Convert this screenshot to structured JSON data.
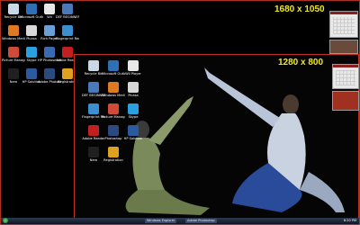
{
  "desktop_outer": {
    "resolution_label": "1680 x 1050",
    "icons": [
      {
        "label": "Recycle Bin",
        "color": "#c9d7e6"
      },
      {
        "label": "Microsoft Outlook",
        "color": "#2f6fb5"
      },
      {
        "label": "Wii",
        "color": "#e8e8e8"
      },
      {
        "label": "DEF BEGINNERS",
        "color": "#4a78b8"
      },
      {
        "label": "Windows Media Player",
        "color": "#e07a20"
      },
      {
        "label": "Picasa",
        "color": "#d8d8d8"
      },
      {
        "label": "Rich Pages",
        "color": "#6aa0d8"
      },
      {
        "label": "Fingerprint Reader",
        "color": "#3a8fd0"
      },
      {
        "label": "Picture Manager",
        "color": "#d04a3a"
      },
      {
        "label": "Skype",
        "color": "#2aa0e0"
      },
      {
        "label": "HP Photosmart",
        "color": "#3a6ab0"
      },
      {
        "label": "Adobe Reader",
        "color": "#c02020"
      },
      {
        "label": "Nero",
        "color": "#202020"
      },
      {
        "label": "HP Solution",
        "color": "#2a5aa0"
      },
      {
        "label": "Adobe Photoshop",
        "color": "#2a4a80"
      },
      {
        "label": "Registration",
        "color": "#e0a020"
      }
    ]
  },
  "desktop_inner": {
    "resolution_label": "1280 x 800",
    "icons": [
      {
        "label": "Recycle Bin",
        "color": "#c9d7e6"
      },
      {
        "label": "Microsoft Outlook",
        "color": "#2f6fb5"
      },
      {
        "label": "Wii Player",
        "color": "#e8e8e8"
      },
      {
        "label": "DEF BEGINNERS",
        "color": "#4a78b8"
      },
      {
        "label": "Windows Media Player",
        "color": "#e07a20"
      },
      {
        "label": "Picasa",
        "color": "#d8d8d8"
      },
      {
        "label": "Fingerprint Reader",
        "color": "#3a8fd0"
      },
      {
        "label": "Picture Manager",
        "color": "#d04a3a"
      },
      {
        "label": "Skype",
        "color": "#2aa0e0"
      },
      {
        "label": "Adobe Reader",
        "color": "#c02020"
      },
      {
        "label": "Photoshop",
        "color": "#2a4a80"
      },
      {
        "label": "HP Solution",
        "color": "#2a5aa0"
      },
      {
        "label": "Nero",
        "color": "#202020"
      },
      {
        "label": "Registration",
        "color": "#e0a020"
      }
    ]
  },
  "taskbar": {
    "items": [
      "Windows Explorer",
      "Adobe Photoshop"
    ],
    "clock": "8:20 PM"
  },
  "colors": {
    "frame": "#c0321f",
    "resolution_text": "#f2e81a",
    "taskbar": "#1a2438"
  }
}
